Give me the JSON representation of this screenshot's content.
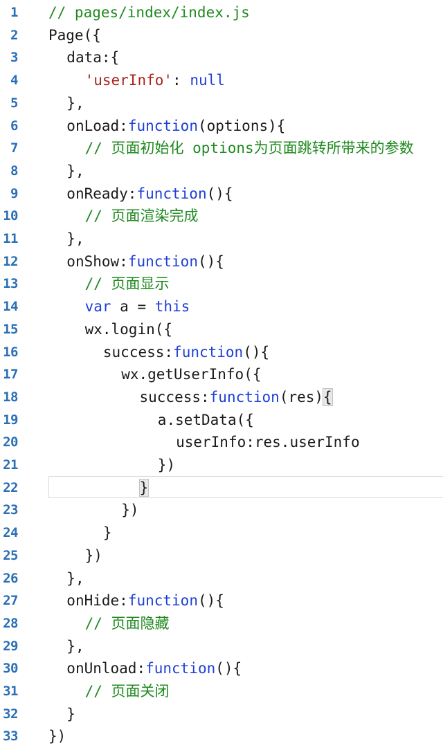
{
  "file_title": "// pages/index/index.js",
  "colors": {
    "background": "#ffffff",
    "line_number": "#2a6fb5",
    "comment": "#1f8a1f",
    "keyword": "#1d3fd6",
    "string": "#a8241c",
    "plain": "#1a1a1a"
  },
  "current_line": 22,
  "lines": [
    {
      "n": "1",
      "indent": 0,
      "tokens": [
        {
          "t": "comment",
          "v": "// pages/index/index.js"
        }
      ]
    },
    {
      "n": "2",
      "indent": 0,
      "tokens": [
        {
          "t": "plain",
          "v": "Page({"
        }
      ]
    },
    {
      "n": "3",
      "indent": 2,
      "tokens": [
        {
          "t": "plain",
          "v": "data:{"
        }
      ]
    },
    {
      "n": "4",
      "indent": 4,
      "tokens": [
        {
          "t": "string",
          "v": "'userInfo'"
        },
        {
          "t": "plain",
          "v": ": "
        },
        {
          "t": "keyword",
          "v": "null"
        }
      ]
    },
    {
      "n": "5",
      "indent": 2,
      "tokens": [
        {
          "t": "plain",
          "v": "},"
        }
      ]
    },
    {
      "n": "6",
      "indent": 2,
      "tokens": [
        {
          "t": "plain",
          "v": "onLoad:"
        },
        {
          "t": "keyword",
          "v": "function"
        },
        {
          "t": "plain",
          "v": "(options){"
        }
      ]
    },
    {
      "n": "7",
      "indent": 4,
      "tokens": [
        {
          "t": "comment",
          "v": "// 页面初始化 options为页面跳转所带来的参数"
        }
      ]
    },
    {
      "n": "8",
      "indent": 2,
      "tokens": [
        {
          "t": "plain",
          "v": "},"
        }
      ]
    },
    {
      "n": "9",
      "indent": 2,
      "tokens": [
        {
          "t": "plain",
          "v": "onReady:"
        },
        {
          "t": "keyword",
          "v": "function"
        },
        {
          "t": "plain",
          "v": "(){"
        }
      ]
    },
    {
      "n": "10",
      "indent": 4,
      "tokens": [
        {
          "t": "comment",
          "v": "// 页面渲染完成"
        }
      ]
    },
    {
      "n": "11",
      "indent": 2,
      "tokens": [
        {
          "t": "plain",
          "v": "},"
        }
      ]
    },
    {
      "n": "12",
      "indent": 2,
      "tokens": [
        {
          "t": "plain",
          "v": "onShow:"
        },
        {
          "t": "keyword",
          "v": "function"
        },
        {
          "t": "plain",
          "v": "(){"
        }
      ]
    },
    {
      "n": "13",
      "indent": 4,
      "tokens": [
        {
          "t": "comment",
          "v": "// 页面显示"
        }
      ]
    },
    {
      "n": "14",
      "indent": 4,
      "tokens": [
        {
          "t": "keyword",
          "v": "var"
        },
        {
          "t": "plain",
          "v": " a = "
        },
        {
          "t": "keyword",
          "v": "this"
        }
      ]
    },
    {
      "n": "15",
      "indent": 4,
      "tokens": [
        {
          "t": "plain",
          "v": "wx.login({"
        }
      ]
    },
    {
      "n": "16",
      "indent": 6,
      "tokens": [
        {
          "t": "plain",
          "v": "success:"
        },
        {
          "t": "keyword",
          "v": "function"
        },
        {
          "t": "plain",
          "v": "(){"
        }
      ]
    },
    {
      "n": "17",
      "indent": 8,
      "tokens": [
        {
          "t": "plain",
          "v": "wx.getUserInfo({"
        }
      ]
    },
    {
      "n": "18",
      "indent": 10,
      "tokens": [
        {
          "t": "plain",
          "v": "success:"
        },
        {
          "t": "keyword",
          "v": "function"
        },
        {
          "t": "plain",
          "v": "(res)"
        },
        {
          "t": "match",
          "v": "{"
        }
      ]
    },
    {
      "n": "19",
      "indent": 12,
      "tokens": [
        {
          "t": "plain",
          "v": "a.setData({"
        }
      ]
    },
    {
      "n": "20",
      "indent": 14,
      "tokens": [
        {
          "t": "plain",
          "v": "userInfo:res.userInfo"
        }
      ]
    },
    {
      "n": "21",
      "indent": 12,
      "tokens": [
        {
          "t": "plain",
          "v": "})"
        }
      ]
    },
    {
      "n": "22",
      "indent": 10,
      "tokens": [
        {
          "t": "match",
          "v": "}"
        }
      ]
    },
    {
      "n": "23",
      "indent": 8,
      "tokens": [
        {
          "t": "plain",
          "v": "})"
        }
      ]
    },
    {
      "n": "24",
      "indent": 6,
      "tokens": [
        {
          "t": "plain",
          "v": "}"
        }
      ]
    },
    {
      "n": "25",
      "indent": 4,
      "tokens": [
        {
          "t": "plain",
          "v": "})"
        }
      ]
    },
    {
      "n": "26",
      "indent": 2,
      "tokens": [
        {
          "t": "plain",
          "v": "},"
        }
      ]
    },
    {
      "n": "27",
      "indent": 2,
      "tokens": [
        {
          "t": "plain",
          "v": "onHide:"
        },
        {
          "t": "keyword",
          "v": "function"
        },
        {
          "t": "plain",
          "v": "(){"
        }
      ]
    },
    {
      "n": "28",
      "indent": 4,
      "tokens": [
        {
          "t": "comment",
          "v": "// 页面隐藏"
        }
      ]
    },
    {
      "n": "29",
      "indent": 2,
      "tokens": [
        {
          "t": "plain",
          "v": "},"
        }
      ]
    },
    {
      "n": "30",
      "indent": 2,
      "tokens": [
        {
          "t": "plain",
          "v": "onUnload:"
        },
        {
          "t": "keyword",
          "v": "function"
        },
        {
          "t": "plain",
          "v": "(){"
        }
      ]
    },
    {
      "n": "31",
      "indent": 4,
      "tokens": [
        {
          "t": "comment",
          "v": "// 页面关闭"
        }
      ]
    },
    {
      "n": "32",
      "indent": 2,
      "tokens": [
        {
          "t": "plain",
          "v": "}"
        }
      ]
    },
    {
      "n": "33",
      "indent": 0,
      "tokens": [
        {
          "t": "plain",
          "v": "})"
        }
      ]
    }
  ]
}
